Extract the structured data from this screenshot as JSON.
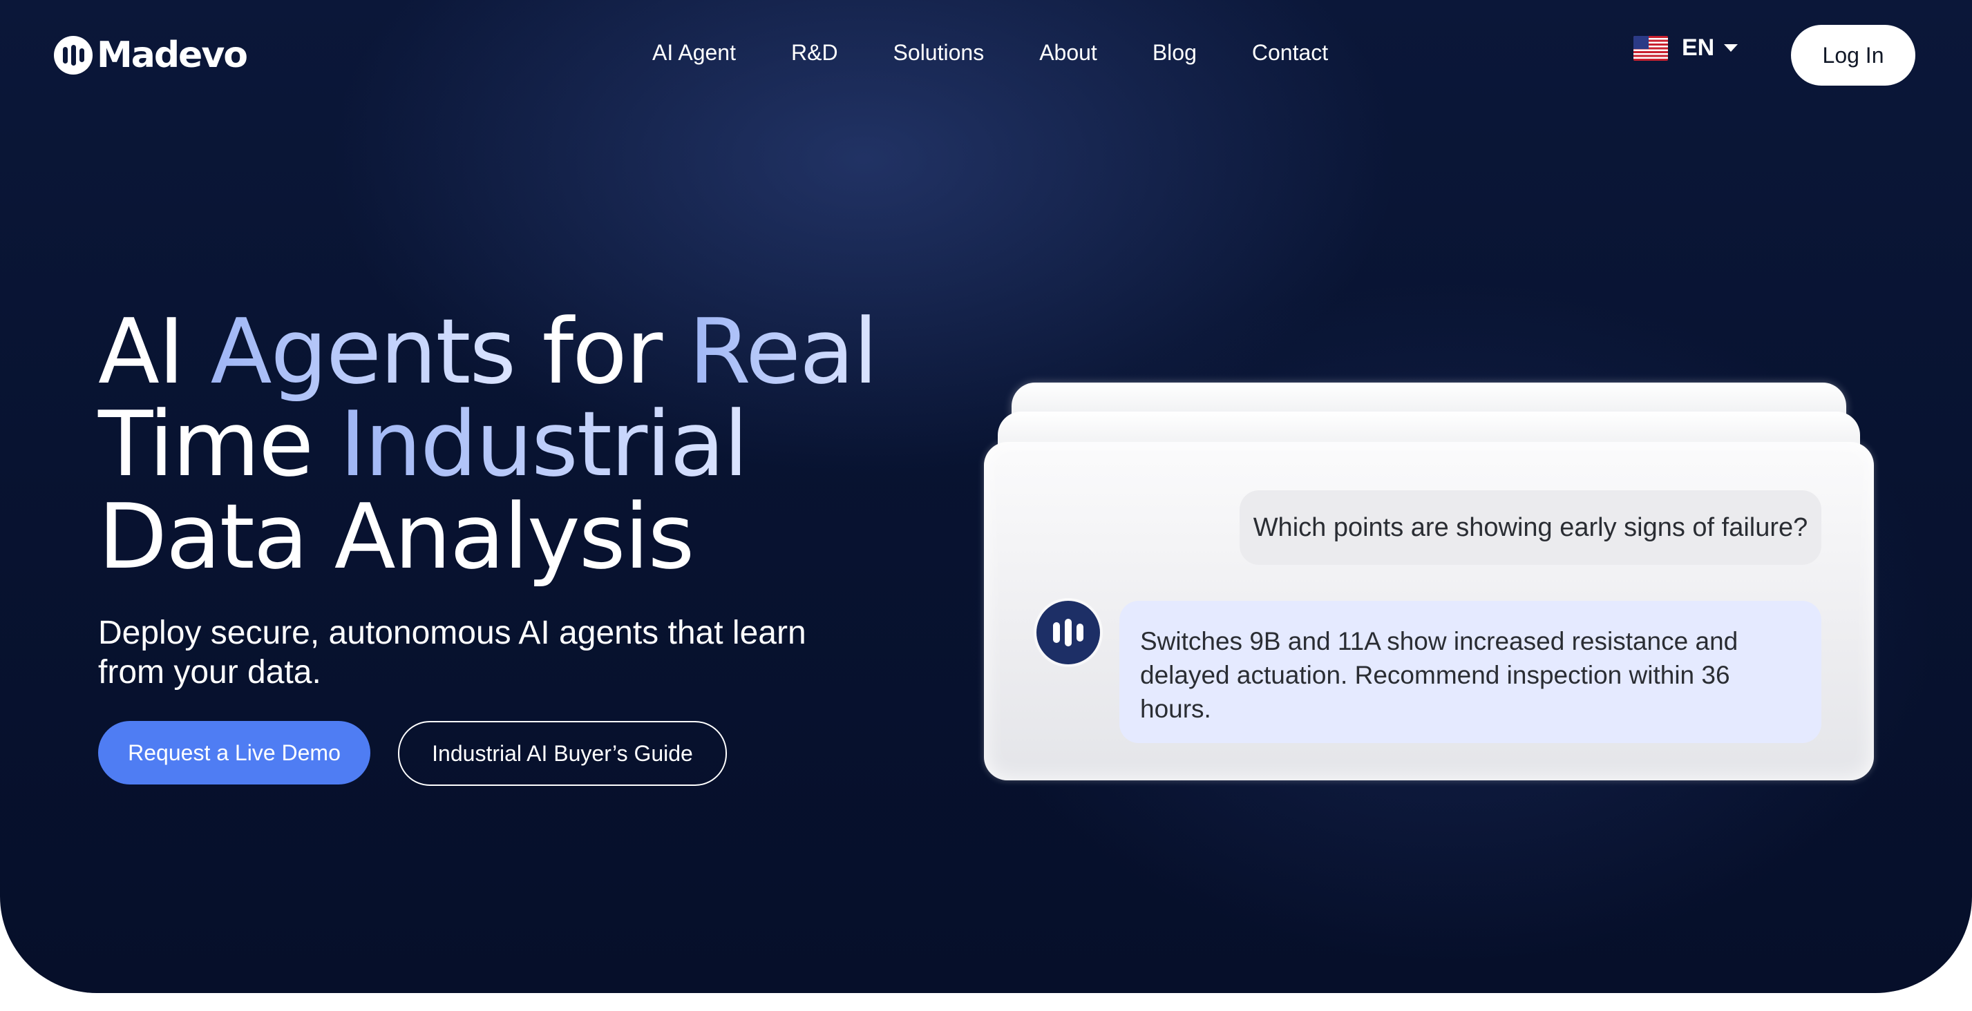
{
  "brand": {
    "name": "Madevo"
  },
  "nav": {
    "items": [
      {
        "label": "AI Agent"
      },
      {
        "label": "R&D"
      },
      {
        "label": "Solutions"
      },
      {
        "label": "About"
      },
      {
        "label": "Blog"
      },
      {
        "label": "Contact"
      }
    ],
    "language": {
      "code": "EN",
      "flag_icon": "us-flag-icon"
    },
    "login_label": "Log In"
  },
  "hero": {
    "headline": {
      "line1_a": "AI ",
      "line1_b": "Agents",
      "line1_c": " for ",
      "line1_d": "Real",
      "line2_a": "Time ",
      "line2_b": "Industrial",
      "line3": "Data Analysis"
    },
    "subtitle": "Deploy secure, autonomous AI agents that learn from your data.",
    "primary_button": "Request a Live Demo",
    "secondary_button": "Industrial AI Buyer’s Guide"
  },
  "chat": {
    "question": "Which points are showing early signs of failure?",
    "answer": "Switches 9B and 11A show increased resistance and delayed actuation. Recommend inspection within 36 hours."
  },
  "colors": {
    "background": "#081331",
    "accent": "#4f7df3",
    "headline_highlight": "#b9c9fb",
    "answer_bubble": "#e5eaff"
  }
}
